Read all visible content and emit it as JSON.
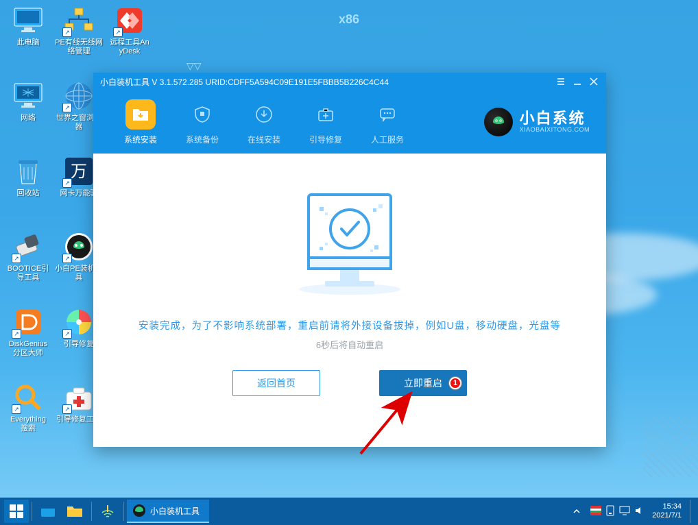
{
  "desktop": {
    "arch_label": "x86",
    "icons": [
      {
        "key": "this-pc",
        "label": "此电脑"
      },
      {
        "key": "pe-net",
        "label": "PE有线无线网络管理"
      },
      {
        "key": "anydesk",
        "label": "远程工具AnyDesk"
      },
      {
        "key": "network",
        "label": "网络"
      },
      {
        "key": "world-browser",
        "label": "世界之窗浏览器"
      },
      {
        "key": "recycle",
        "label": "回收站"
      },
      {
        "key": "wanka",
        "label": "网卡万能驱"
      },
      {
        "key": "bootice",
        "label": "BOOTICE引导工具"
      },
      {
        "key": "xiaobai-pe",
        "label": "小白PE装机工具"
      },
      {
        "key": "diskgenius",
        "label": "DiskGenius分区大师"
      },
      {
        "key": "bootfix",
        "label": "引导修复"
      },
      {
        "key": "everything",
        "label": "Everything搜索"
      },
      {
        "key": "bootrepair",
        "label": "引导修复工具"
      }
    ]
  },
  "window": {
    "title": "小白装机工具 V 3.1.572.285 URID:CDFF5A594C09E191E5FBBB5B226C4C44",
    "nav": [
      {
        "label": "系统安装",
        "icon": "folder"
      },
      {
        "label": "系统备份",
        "icon": "shield"
      },
      {
        "label": "在线安装",
        "icon": "download"
      },
      {
        "label": "引导修复",
        "icon": "medkit"
      },
      {
        "label": "人工服务",
        "icon": "chat"
      }
    ],
    "brand": {
      "main": "小白系统",
      "sub": "XIAOBAIXITONG.COM"
    },
    "message_primary": "安装完成，为了不影响系统部署，重启前请将外接设备拔掉，例如U盘，移动硬盘，光盘等",
    "message_secondary": "6秒后将自动重启",
    "buttons": {
      "back": "返回首页",
      "restart": "立即重启"
    },
    "callout": "1"
  },
  "taskbar": {
    "active_app": "小白装机工具",
    "time": "15:34",
    "date": "2021/7/1"
  }
}
